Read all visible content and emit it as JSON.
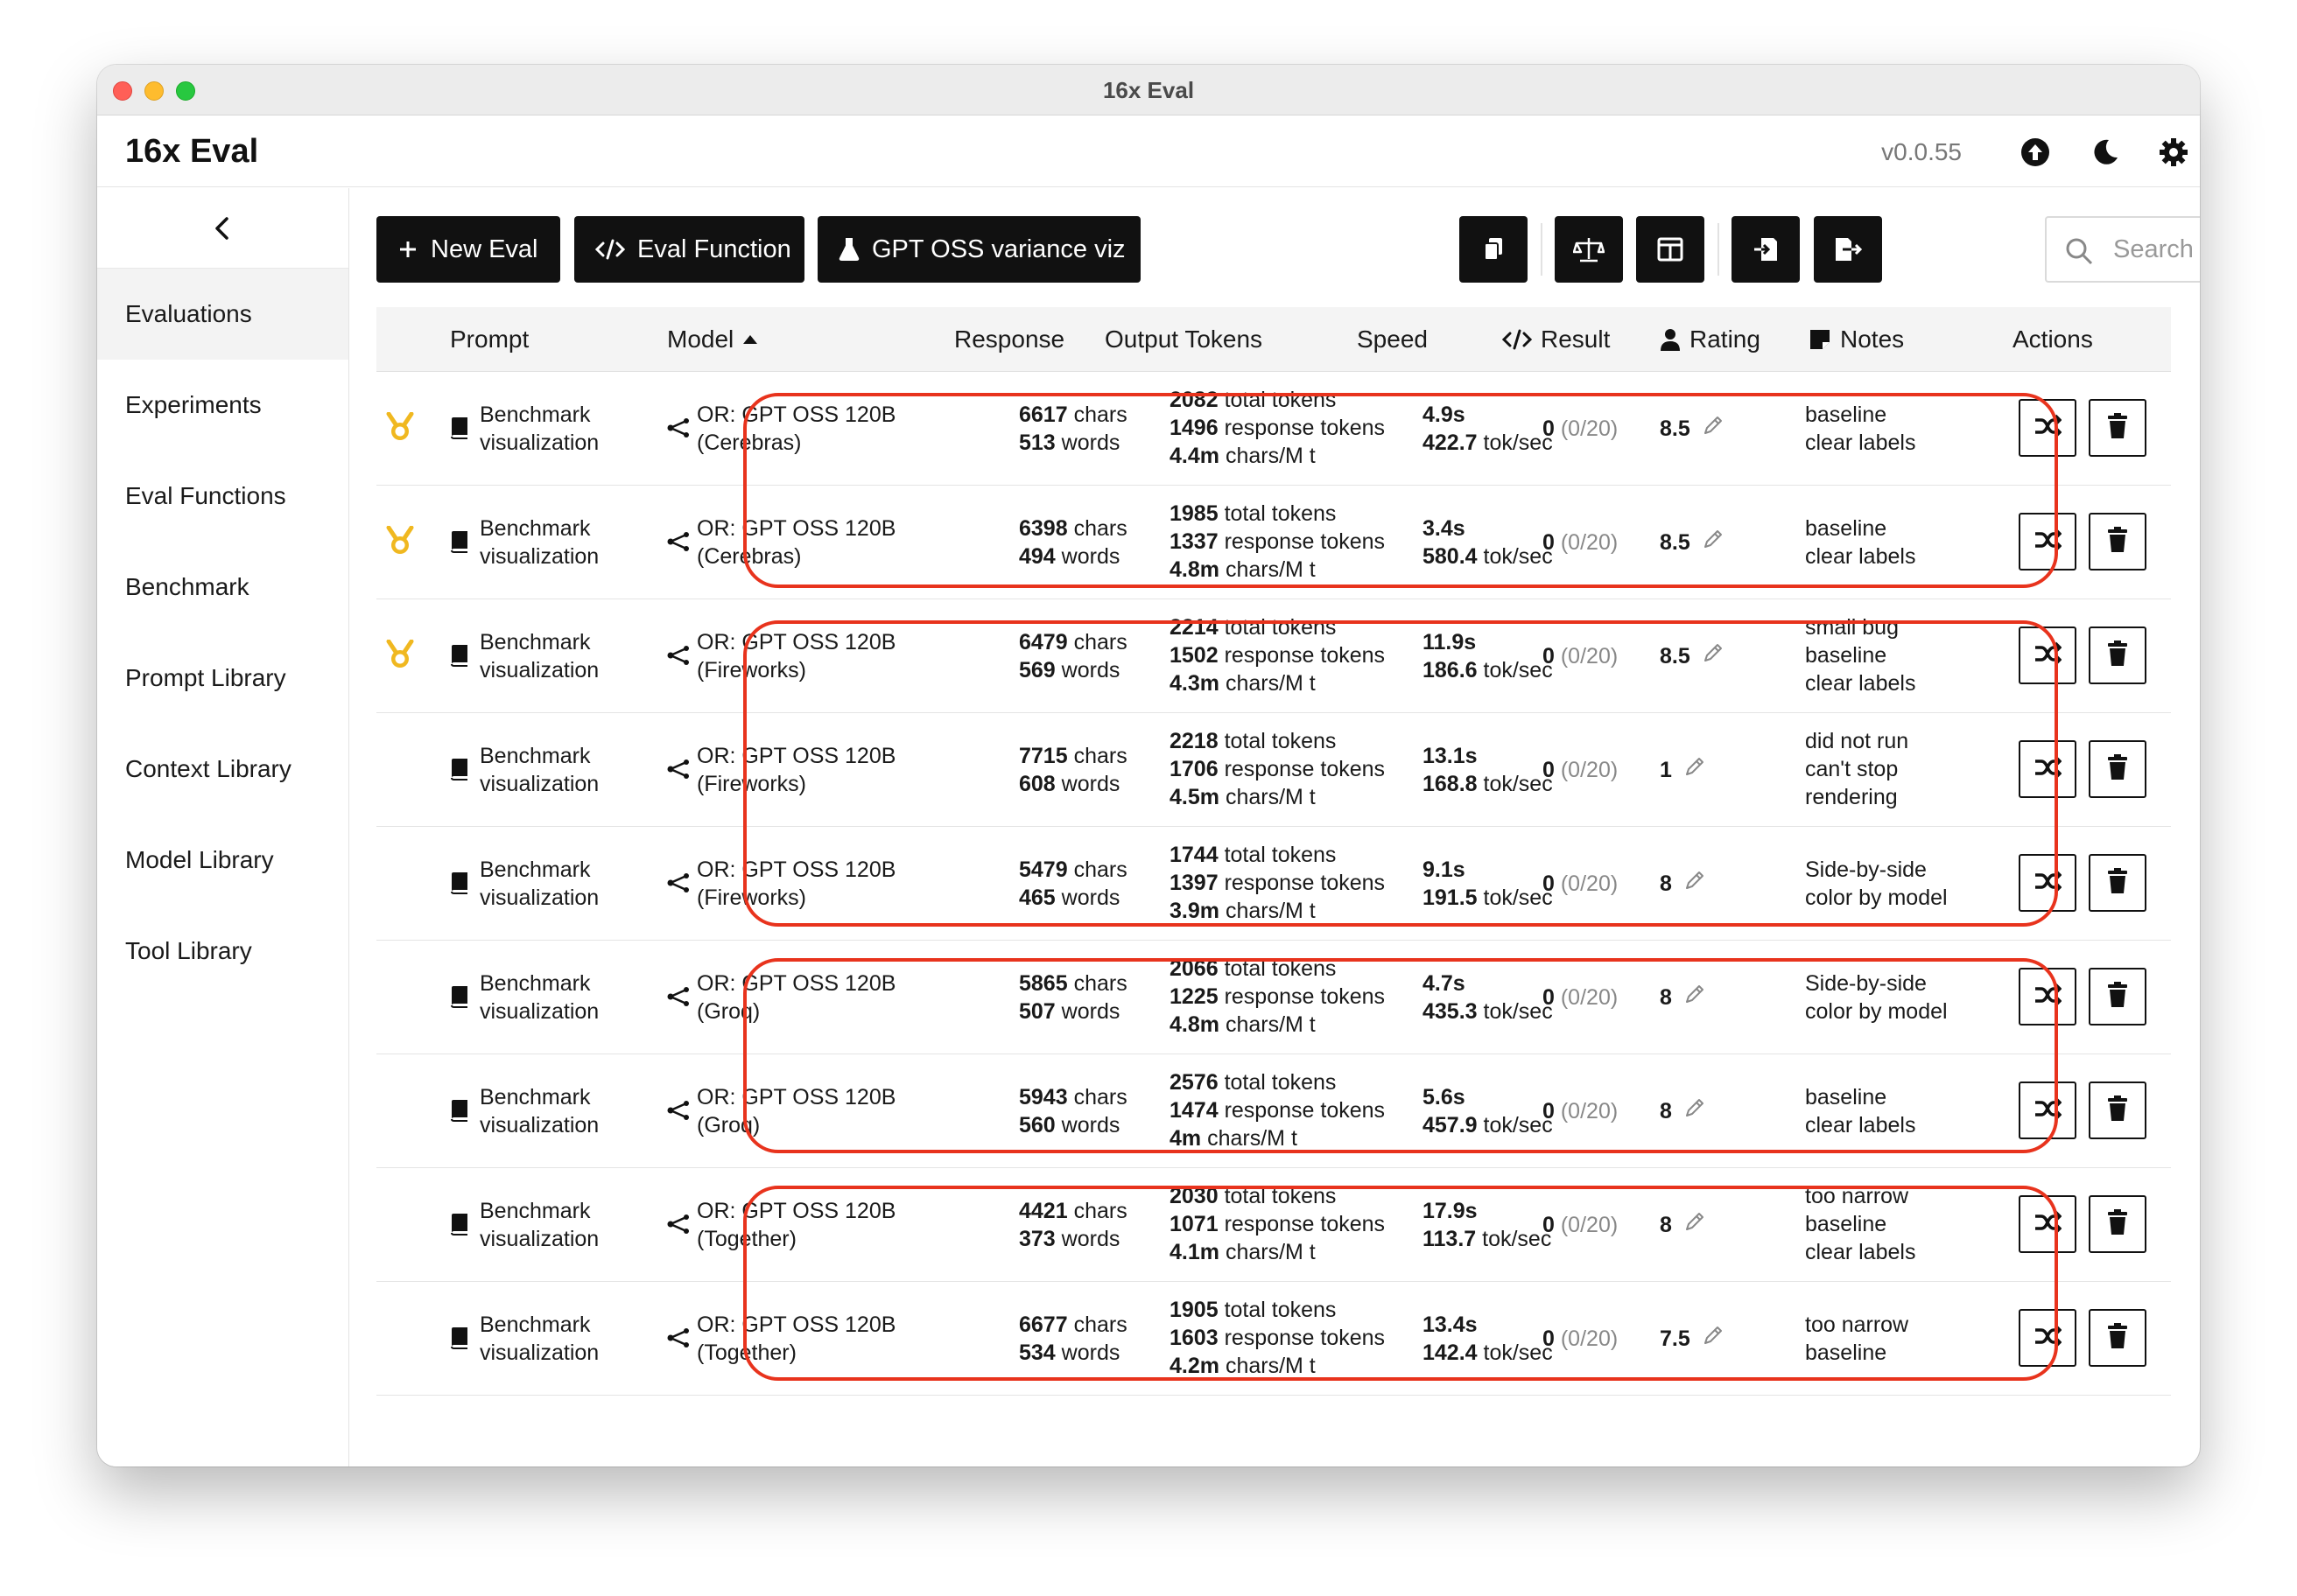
{
  "window": {
    "title": "16x Eval"
  },
  "app": {
    "title": "16x Eval",
    "version": "v0.0.55"
  },
  "sidebar": {
    "items": [
      {
        "label": "Evaluations",
        "active": true
      },
      {
        "label": "Experiments"
      },
      {
        "label": "Eval Functions"
      },
      {
        "label": "Benchmark"
      },
      {
        "label": "Prompt Library"
      },
      {
        "label": "Context Library"
      },
      {
        "label": "Model Library"
      },
      {
        "label": "Tool Library"
      }
    ]
  },
  "toolbar": {
    "new_eval": "New Eval",
    "eval_function": "Eval Function",
    "viz": "GPT OSS variance viz",
    "search_placeholder": "Search"
  },
  "table": {
    "headers": {
      "prompt": "Prompt",
      "model": "Model",
      "response": "Response",
      "output_tokens": "Output Tokens",
      "speed": "Speed",
      "result": "Result",
      "rating": "Rating",
      "notes": "Notes",
      "actions": "Actions"
    },
    "rows": [
      {
        "medal": true,
        "prompt": [
          "Benchmark",
          "visualization"
        ],
        "model": [
          "OR: GPT OSS 120B",
          "(Cerebras)"
        ],
        "chars": "6617",
        "chars_unit": "chars",
        "words": "513",
        "words_unit": "words",
        "total_tokens": "2082",
        "total_unit": "total tokens",
        "resp_tokens": "1496",
        "resp_unit": "response tokens",
        "cpm": "4.4m",
        "cpm_unit": "chars/M t",
        "time": "4.9s",
        "tps": "422.7",
        "tps_unit": "tok/sec",
        "result": "0",
        "result_detail": "(0/20)",
        "rating": "8.5",
        "notes": [
          "baseline",
          "clear labels"
        ]
      },
      {
        "medal": true,
        "prompt": [
          "Benchmark",
          "visualization"
        ],
        "model": [
          "OR: GPT OSS 120B",
          "(Cerebras)"
        ],
        "chars": "6398",
        "chars_unit": "chars",
        "words": "494",
        "words_unit": "words",
        "total_tokens": "1985",
        "total_unit": "total tokens",
        "resp_tokens": "1337",
        "resp_unit": "response tokens",
        "cpm": "4.8m",
        "cpm_unit": "chars/M t",
        "time": "3.4s",
        "tps": "580.4",
        "tps_unit": "tok/sec",
        "result": "0",
        "result_detail": "(0/20)",
        "rating": "8.5",
        "notes": [
          "baseline",
          "clear labels"
        ]
      },
      {
        "medal": true,
        "prompt": [
          "Benchmark",
          "visualization"
        ],
        "model": [
          "OR: GPT OSS 120B",
          "(Fireworks)"
        ],
        "chars": "6479",
        "chars_unit": "chars",
        "words": "569",
        "words_unit": "words",
        "total_tokens": "2214",
        "total_unit": "total tokens",
        "resp_tokens": "1502",
        "resp_unit": "response tokens",
        "cpm": "4.3m",
        "cpm_unit": "chars/M t",
        "time": "11.9s",
        "tps": "186.6",
        "tps_unit": "tok/sec",
        "result": "0",
        "result_detail": "(0/20)",
        "rating": "8.5",
        "notes": [
          "small bug",
          "baseline",
          "clear labels"
        ]
      },
      {
        "medal": false,
        "prompt": [
          "Benchmark",
          "visualization"
        ],
        "model": [
          "OR: GPT OSS 120B",
          "(Fireworks)"
        ],
        "chars": "7715",
        "chars_unit": "chars",
        "words": "608",
        "words_unit": "words",
        "total_tokens": "2218",
        "total_unit": "total tokens",
        "resp_tokens": "1706",
        "resp_unit": "response tokens",
        "cpm": "4.5m",
        "cpm_unit": "chars/M t",
        "time": "13.1s",
        "tps": "168.8",
        "tps_unit": "tok/sec",
        "result": "0",
        "result_detail": "(0/20)",
        "rating": "1",
        "notes": [
          "did not run",
          "can't stop",
          "rendering"
        ]
      },
      {
        "medal": false,
        "prompt": [
          "Benchmark",
          "visualization"
        ],
        "model": [
          "OR: GPT OSS 120B",
          "(Fireworks)"
        ],
        "chars": "5479",
        "chars_unit": "chars",
        "words": "465",
        "words_unit": "words",
        "total_tokens": "1744",
        "total_unit": "total tokens",
        "resp_tokens": "1397",
        "resp_unit": "response tokens",
        "cpm": "3.9m",
        "cpm_unit": "chars/M t",
        "time": "9.1s",
        "tps": "191.5",
        "tps_unit": "tok/sec",
        "result": "0",
        "result_detail": "(0/20)",
        "rating": "8",
        "notes": [
          "Side-by-side",
          "color by model"
        ]
      },
      {
        "medal": false,
        "prompt": [
          "Benchmark",
          "visualization"
        ],
        "model": [
          "OR: GPT OSS 120B",
          "(Groq)"
        ],
        "chars": "5865",
        "chars_unit": "chars",
        "words": "507",
        "words_unit": "words",
        "total_tokens": "2066",
        "total_unit": "total tokens",
        "resp_tokens": "1225",
        "resp_unit": "response tokens",
        "cpm": "4.8m",
        "cpm_unit": "chars/M t",
        "time": "4.7s",
        "tps": "435.3",
        "tps_unit": "tok/sec",
        "result": "0",
        "result_detail": "(0/20)",
        "rating": "8",
        "notes": [
          "Side-by-side",
          "color by model"
        ]
      },
      {
        "medal": false,
        "prompt": [
          "Benchmark",
          "visualization"
        ],
        "model": [
          "OR: GPT OSS 120B",
          "(Groq)"
        ],
        "chars": "5943",
        "chars_unit": "chars",
        "words": "560",
        "words_unit": "words",
        "total_tokens": "2576",
        "total_unit": "total tokens",
        "resp_tokens": "1474",
        "resp_unit": "response tokens",
        "cpm": "4m",
        "cpm_unit": "chars/M t",
        "time": "5.6s",
        "tps": "457.9",
        "tps_unit": "tok/sec",
        "result": "0",
        "result_detail": "(0/20)",
        "rating": "8",
        "notes": [
          "baseline",
          "clear labels"
        ]
      },
      {
        "medal": false,
        "prompt": [
          "Benchmark",
          "visualization"
        ],
        "model": [
          "OR: GPT OSS 120B",
          "(Together)"
        ],
        "chars": "4421",
        "chars_unit": "chars",
        "words": "373",
        "words_unit": "words",
        "total_tokens": "2030",
        "total_unit": "total tokens",
        "resp_tokens": "1071",
        "resp_unit": "response tokens",
        "cpm": "4.1m",
        "cpm_unit": "chars/M t",
        "time": "17.9s",
        "tps": "113.7",
        "tps_unit": "tok/sec",
        "result": "0",
        "result_detail": "(0/20)",
        "rating": "8",
        "notes": [
          "too narrow",
          "baseline",
          "clear labels"
        ]
      },
      {
        "medal": false,
        "prompt": [
          "Benchmark",
          "visualization"
        ],
        "model": [
          "OR: GPT OSS 120B",
          "(Together)"
        ],
        "chars": "6677",
        "chars_unit": "chars",
        "words": "534",
        "words_unit": "words",
        "total_tokens": "1905",
        "total_unit": "total tokens",
        "resp_tokens": "1603",
        "resp_unit": "response tokens",
        "cpm": "4.2m",
        "cpm_unit": "chars/M t",
        "time": "13.4s",
        "tps": "142.4",
        "tps_unit": "tok/sec",
        "result": "0",
        "result_detail": "(0/20)",
        "rating": "7.5",
        "notes": [
          "too narrow",
          "baseline"
        ]
      }
    ]
  },
  "colors": {
    "highlight": "#e8331d",
    "medal": "#f0b820",
    "primary": "#111111"
  },
  "icons": {
    "new_eval": "plus-icon",
    "eval_function": "code-icon",
    "viz": "flask-icon",
    "tool1": "copy-icon",
    "tool2": "scale-icon",
    "tool3": "columns-icon",
    "tool4": "import-icon",
    "tool5": "export-icon",
    "row_actions": [
      "shuffle-icon",
      "trash-icon"
    ]
  }
}
